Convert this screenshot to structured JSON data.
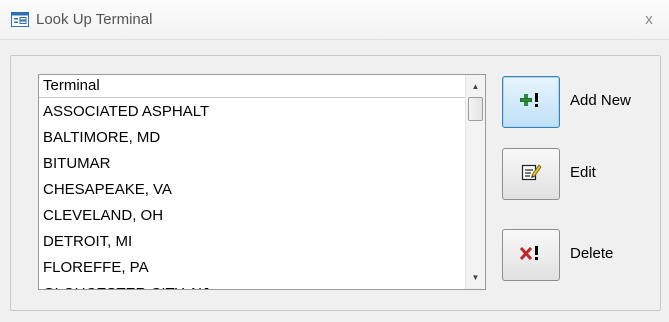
{
  "window": {
    "title": "Look Up Terminal",
    "close_label": "x"
  },
  "listbox": {
    "header": "Terminal",
    "items": [
      "ASSOCIATED ASPHALT",
      "BALTIMORE, MD",
      "BITUMAR",
      "CHESAPEAKE, VA",
      "CLEVELAND, OH",
      "DETROIT, MI",
      "FLOREFFE, PA",
      "GLOUCESTER CITY, NJ"
    ]
  },
  "buttons": {
    "add_new": "Add New",
    "edit": "Edit",
    "delete": "Delete"
  },
  "icons": {
    "title": "form-icon",
    "add": "add-record-icon",
    "edit": "edit-record-icon",
    "delete": "delete-record-icon"
  },
  "colors": {
    "add_icon": "#2e8b3a",
    "delete_icon": "#c0262b",
    "active_button": "#bfe0f7"
  }
}
